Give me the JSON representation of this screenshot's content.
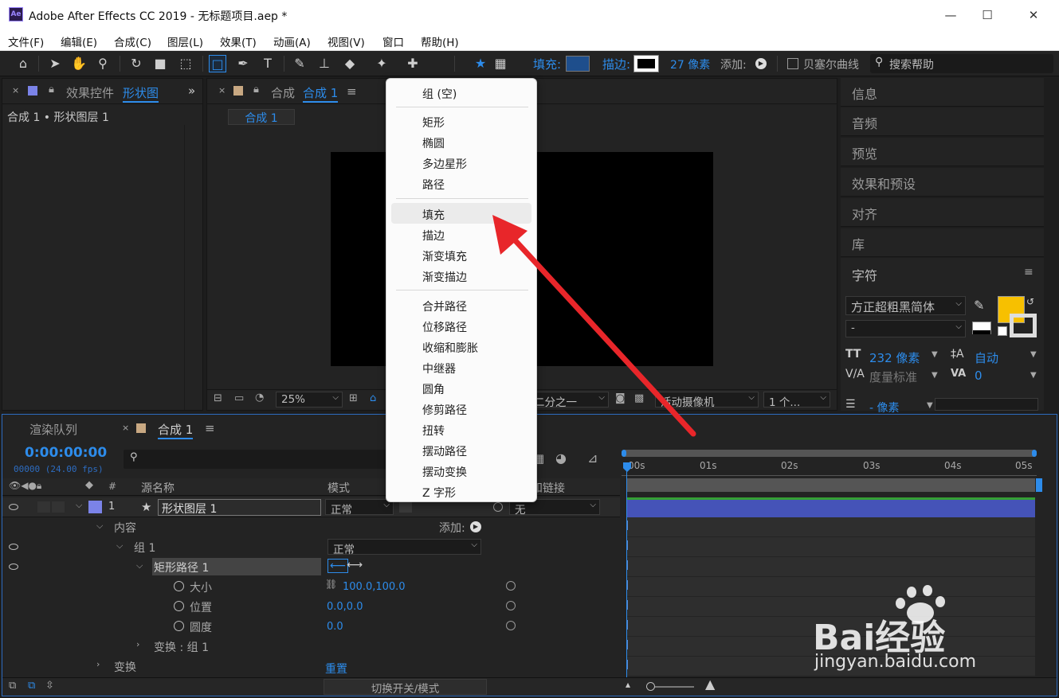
{
  "window": {
    "title": "Adobe After Effects CC 2019 - 无标题项目.aep *",
    "app_icon": "Ae",
    "controls": [
      "—",
      "☐",
      "✕"
    ]
  },
  "menu": [
    "文件(F)",
    "编辑(E)",
    "合成(C)",
    "图层(L)",
    "效果(T)",
    "动画(A)",
    "视图(V)",
    "窗口",
    "帮助(H)"
  ],
  "toolbar": {
    "fill_label": "填充:",
    "stroke_label": "描边:",
    "stroke_width": "27 像素",
    "add_label": "添加:",
    "bezier_label": "贝塞尔曲线",
    "search_help": "搜索帮助"
  },
  "effects_panel": {
    "tab_prefix": "效果控件",
    "tab_layer": "形状图",
    "subtitle": "合成 1 • 形状图层 1"
  },
  "comp_panel": {
    "tab_prefix": "合成",
    "tab_name": "合成 1",
    "comp_chip": "合成 1",
    "zoom": "25%",
    "resolution": "二分之一",
    "camera": "活动摄像机",
    "views": "1 个..."
  },
  "context_menu": {
    "group_empty": "组 (空)",
    "shapes": [
      "矩形",
      "椭圆",
      "多边星形",
      "路径"
    ],
    "fills": [
      "填充",
      "描边",
      "渐变填充",
      "渐变描边"
    ],
    "operators": [
      "合并路径",
      "位移路径",
      "收缩和膨胀",
      "中继器",
      "圆角",
      "修剪路径",
      "扭转",
      "摆动路径",
      "摆动变换",
      "Z 字形"
    ],
    "highlighted": "填充"
  },
  "right_panels": [
    "信息",
    "音频",
    "预览",
    "效果和预设",
    "对齐",
    "库"
  ],
  "character_panel": {
    "title": "字符",
    "font": "方正超粗黑简体",
    "style": "-",
    "size": "232 像素",
    "leading": "自动",
    "kerning": "度量标准",
    "tracking": "0",
    "bottom_row": "- 像素",
    "fill_color": "#f7c000"
  },
  "timeline": {
    "tab_render": "渲染队列",
    "tab_comp": "合成 1",
    "timecode": "0:00:00:00",
    "frame_info": "00000 (24.00 fps)",
    "ruler": [
      "00s",
      "01s",
      "02s",
      "03s",
      "04s",
      "05s"
    ],
    "columns": {
      "num": "#",
      "source": "源名称",
      "mode": "模式",
      "parent": "父级和链接"
    },
    "layer": {
      "index": "1",
      "name": "形状图层 1",
      "mode": "正常",
      "parent": "无",
      "label_color": "#7b83e8"
    },
    "rows": {
      "contents": "内容",
      "add": "添加:",
      "group": "组 1",
      "group_mode": "正常",
      "rect_path": "矩形路径 1",
      "size_label": "大小",
      "size_value": "100.0,100.0",
      "position_label": "位置",
      "position_value": "0.0,0.0",
      "roundness_label": "圆度",
      "roundness_value": "0.0",
      "group_transform": "变换 : 组 1",
      "transform": "变换",
      "reset": "重置"
    },
    "footer": "切换开关/模式"
  },
  "watermark": {
    "brand": "Bai经验",
    "url": "jingyan.baidu.com"
  }
}
